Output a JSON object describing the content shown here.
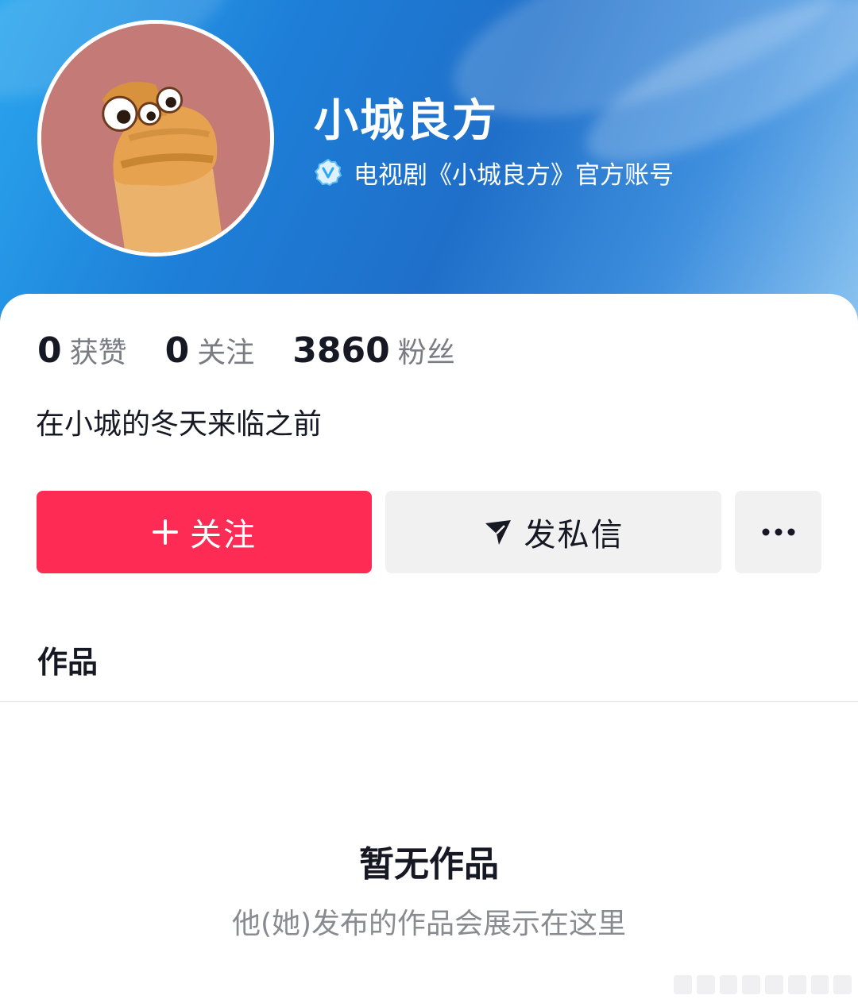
{
  "profile": {
    "name": "小城良方",
    "verification": "电视剧《小城良方》官方账号",
    "bio": "在小城的冬天来临之前"
  },
  "stats": [
    {
      "num": "0",
      "label": "获赞"
    },
    {
      "num": "0",
      "label": "关注"
    },
    {
      "num": "3860",
      "label": "粉丝"
    }
  ],
  "actions": {
    "follow_label": "关注",
    "message_label": "发私信"
  },
  "tabs": {
    "works_label": "作品"
  },
  "empty_state": {
    "title": "暂无作品",
    "description": "他(她)发布的作品会展示在这里"
  },
  "colors": {
    "follow_button": "#fe2c55",
    "header_blue": "#1f6fc9",
    "secondary_button": "#f1f1f2"
  },
  "icons": {
    "verify": "verified-badge-icon",
    "follow": "plus-icon",
    "message": "send-icon",
    "more": "more-dots-icon"
  }
}
